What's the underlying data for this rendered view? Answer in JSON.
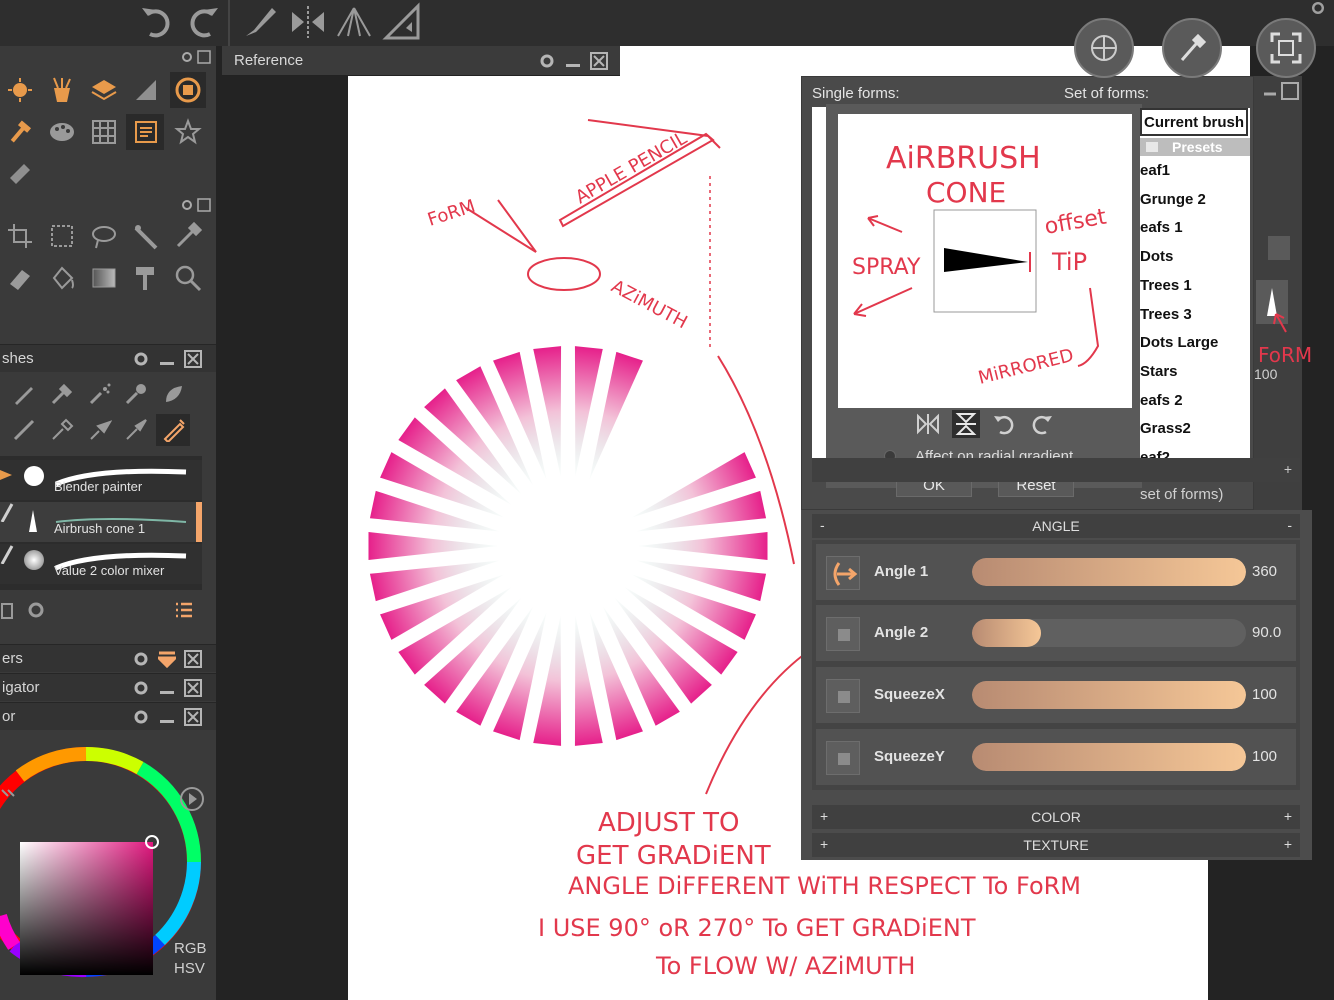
{
  "toolbar": {
    "icons": [
      "undo-icon",
      "redo-icon",
      "brush-icon",
      "symmetry-icon",
      "perspective-icon",
      "ruler-icon"
    ]
  },
  "reference": {
    "title": "Reference"
  },
  "left_panel": {
    "brushes_header": "shes",
    "brushes": [
      {
        "name": "Blender painter"
      },
      {
        "name": "Airbrush cone 1"
      },
      {
        "name": "Value 2 color mixer"
      }
    ],
    "layers_header": "ers",
    "navigator_header": "igator",
    "color_header": "or",
    "color_modes": {
      "rgb": "RGB",
      "hsv": "HSV"
    }
  },
  "forms_dialog": {
    "single_forms_label": "Single forms:",
    "set_of_forms_label": "Set of forms:",
    "current_brush": "Current brush",
    "presets_label": "Presets",
    "set_items": [
      "eaf1",
      "Grunge 2",
      "eafs 1",
      "Dots",
      "Trees 1",
      "Trees 3",
      "Dots Large",
      "Stars",
      "eafs 2",
      "Grass2",
      "eaf2"
    ],
    "affect_radial": "Affect on radial gradient",
    "ok_label": "OK",
    "reset_label": "Reset",
    "set_footer": "set of forms)"
  },
  "right_panel": {
    "partial_value": "100",
    "angle_section": "ANGLE",
    "sliders": [
      {
        "label": "Angle 1",
        "value": "360",
        "fraction": 1.0
      },
      {
        "label": "Angle 2",
        "value": "90.0",
        "fraction": 0.25
      },
      {
        "label": "SqueezeX",
        "value": "100",
        "fraction": 1.0
      },
      {
        "label": "SqueezeY",
        "value": "100",
        "fraction": 1.0
      }
    ],
    "color_section": "COLOR",
    "texture_section": "TEXTURE"
  },
  "annotations": {
    "form": "FoRM",
    "apple_pencil": "APPLE PENCIL",
    "azimuth": "AZiMUTH",
    "airbrush": "AiRBRUSH",
    "cone": "CONE",
    "spray": "SPRAY",
    "offset": "offset",
    "tip": "TiP",
    "mirrored": "MiRRORED",
    "form_right": "FoRM",
    "note_lines": [
      "ADJUST TO",
      "GET GRADiENT",
      "ANGLE DiFFERENT   WiTH RESPECT To FoRM",
      "I USE 90° oR 270°  To  GET GRADiENT",
      "To  FLOW  W/ AZiMUTH"
    ]
  },
  "colors": {
    "accent": "#f4a56a",
    "annotation": "#e2384c",
    "gradient_end": "#f3c595"
  }
}
